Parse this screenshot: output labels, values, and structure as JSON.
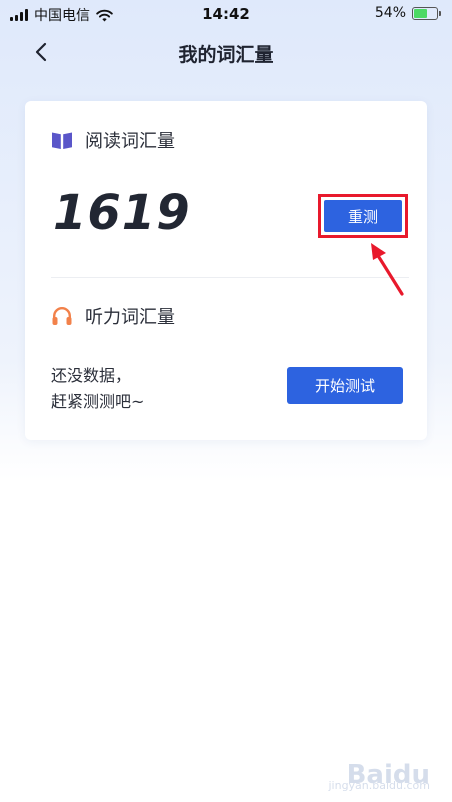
{
  "status_bar": {
    "carrier": "中国电信",
    "time": "14:42",
    "battery_percent": "54%",
    "battery_level": 0.54
  },
  "nav": {
    "title": "我的词汇量",
    "back_icon": "chevron-left-icon"
  },
  "reading": {
    "label": "阅读词汇量",
    "icon": "book-icon",
    "icon_color": "#5a56c9",
    "score": "1619",
    "retest_label": "重测"
  },
  "listening": {
    "label": "听力词汇量",
    "icon": "headphones-icon",
    "icon_color": "#f2814a",
    "empty_line1": "还没数据，",
    "empty_line2": "赶紧测测吧~",
    "start_label": "开始测试"
  },
  "colors": {
    "primary_button": "#2d63e0",
    "annotation": "#e8192c"
  },
  "watermark": {
    "brand": "Baidu",
    "sub": "jingyan.baidu.com"
  }
}
